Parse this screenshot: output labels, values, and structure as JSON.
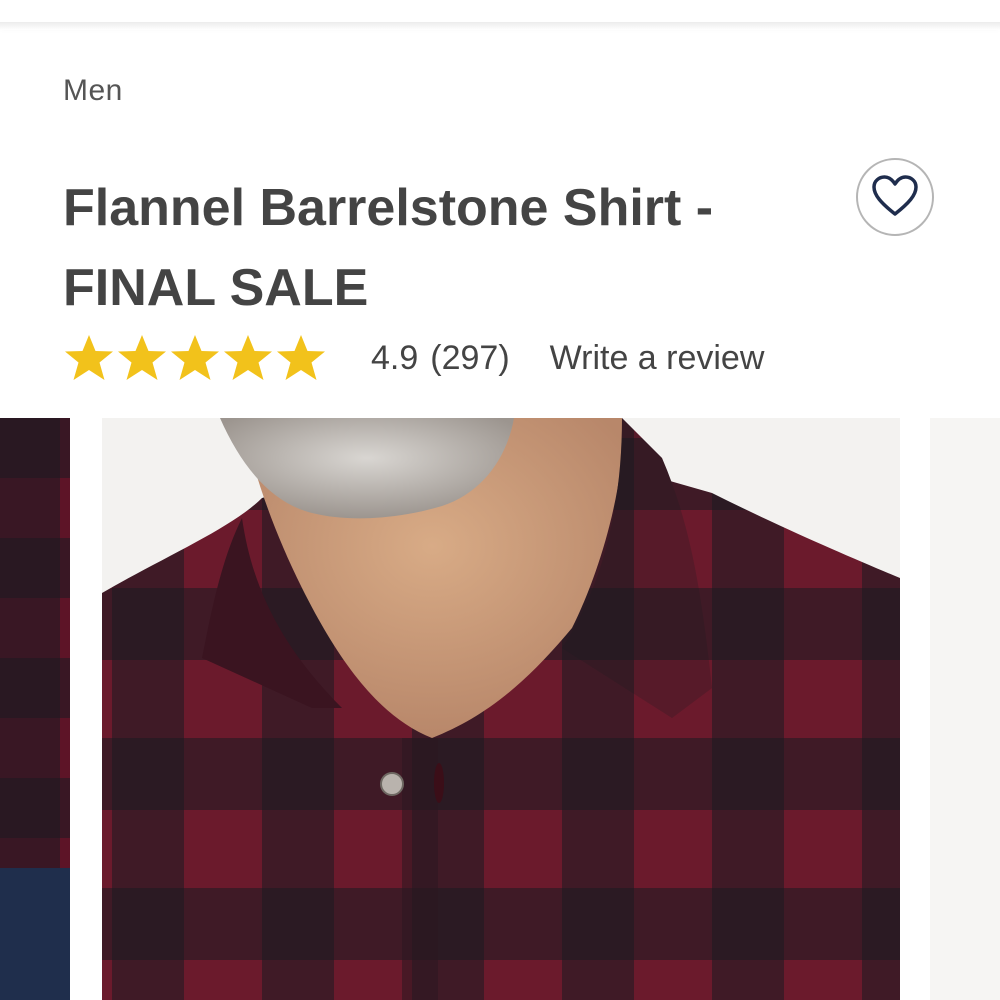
{
  "breadcrumb": {
    "label": "Men"
  },
  "product": {
    "title_line1": "Flannel Barrelstone Shirt -",
    "title_line2": "FINAL SALE"
  },
  "rating": {
    "stars": 5,
    "value": "4.9",
    "count": "(297)",
    "write_review_label": "Write a review",
    "star_color": "#f2c21b"
  },
  "wishlist": {
    "icon": "heart-icon",
    "color": "#1f2d4d"
  },
  "gallery": {
    "images": [
      {
        "name": "thumbnail-left",
        "icon": "plaid-shirt-photo"
      },
      {
        "name": "main-image",
        "icon": "plaid-shirt-photo"
      },
      {
        "name": "thumbnail-right",
        "icon": "light-background-photo"
      }
    ],
    "colors": {
      "burgundy": "#6b1a2c",
      "black": "#1c1a20"
    }
  }
}
